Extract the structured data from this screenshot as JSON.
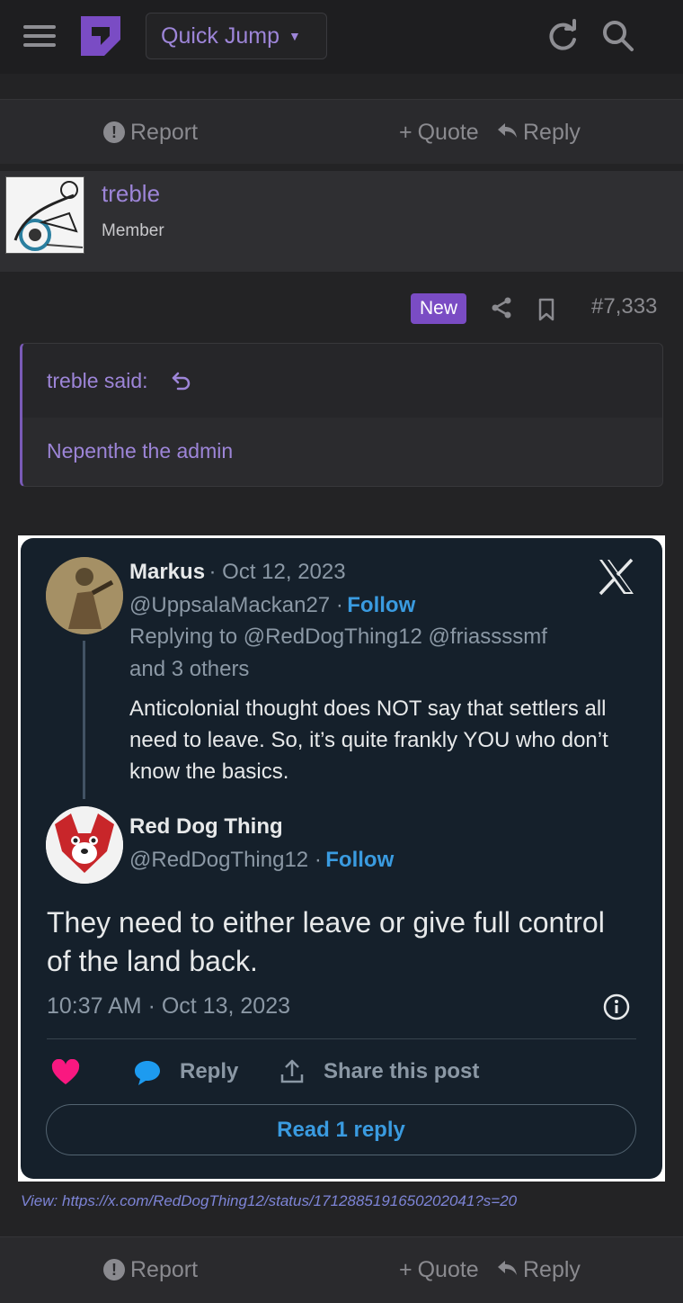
{
  "topbar": {
    "quick_jump_label": "Quick Jump"
  },
  "actions": {
    "report": "Report",
    "quote": "Quote",
    "reply": "Reply"
  },
  "user": {
    "name": "treble",
    "title": "Member"
  },
  "post": {
    "badge": "New",
    "number": "#7,333"
  },
  "quote": {
    "author": "treble said:",
    "text": "Nepenthe the admin"
  },
  "tweet": {
    "reply_tweet": {
      "name": "Markus",
      "date": "· Oct 12, 2023",
      "handle": "@UppsalaMackan27 ·",
      "follow": "Follow",
      "replying_to": "Replying to @RedDogThing12 @friassssmf",
      "replying_more": "and 3 others",
      "text": "Anticolonial thought does NOT say that settlers all need to leave. So, it’s quite frankly YOU who don’t know the basics."
    },
    "main_tweet": {
      "name": "Red Dog Thing",
      "handle": "@RedDogThing12 ·",
      "follow": "Follow",
      "text": "They need to either leave or give full control of the land back.",
      "timestamp": "10:37 AM · Oct 13, 2023"
    },
    "reply_label": "Reply",
    "share_label": "Share this post",
    "read_replies": "Read 1 reply"
  },
  "embed_link": "View: https://x.com/RedDogThing12/status/1712885191650202041?s=20",
  "colors": {
    "accent": "#9d85d8",
    "badge": "#7a4cc4",
    "tweet_bg": "#15202b",
    "link_blue": "#3a9be0",
    "heart": "#f91880"
  }
}
